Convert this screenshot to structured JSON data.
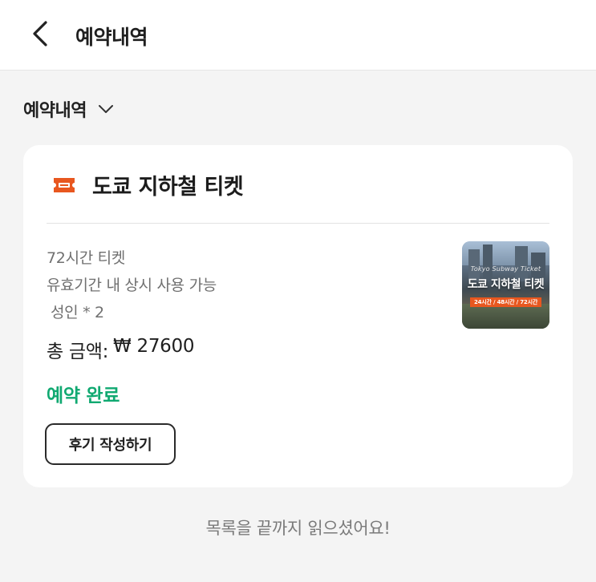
{
  "header": {
    "title": "예약내역",
    "back_icon": "chevron-left-icon"
  },
  "filter": {
    "label": "예약내역",
    "icon": "chevron-down-icon"
  },
  "reservation": {
    "title": "도쿄 지하철 티켓",
    "icon": "ticket-icon",
    "icon_color": "#e8571f",
    "details": [
      "72시간 티켓",
      "유효기간 내 상시 사용 가능",
      "성인 * 2"
    ],
    "price_label": "총 금액:",
    "price_value": "₩ 27600",
    "status": "예약 완료",
    "status_color": "#10a971",
    "review_button": "후기 작성하기",
    "thumbnail": {
      "subtitle": "Tokyo Subway Ticket",
      "title": "도쿄 지하철 티켓",
      "tags": "24시간 / 48시간 / 72시간"
    }
  },
  "end_message": "목록을 끝까지 읽으셨어요!"
}
